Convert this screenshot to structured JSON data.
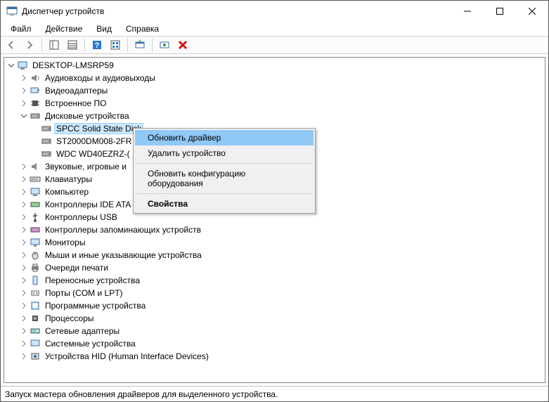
{
  "window": {
    "title": "Диспетчер устройств"
  },
  "menu": {
    "file": "Файл",
    "action": "Действие",
    "view": "Вид",
    "help": "Справка"
  },
  "tree": {
    "root": "DESKTOP-LMSRP59",
    "audio": "Аудиовходы и аудиовыходы",
    "video": "Видеоадаптеры",
    "firmware": "Встроенное ПО",
    "disks": "Дисковые устройства",
    "disk0": "SPCC Solid State Disk",
    "disk1": "ST2000DM008-2FR",
    "disk2": "WDC WD40EZRZ-(",
    "sound": "Звуковые, игровые и",
    "keyboards": "Клавиатуры",
    "computer": "Компьютер",
    "ide": "Контроллеры IDE ATA",
    "usb": "Контроллеры USB",
    "storage": "Контроллеры запоминающих устройств",
    "monitors": "Мониторы",
    "mice": "Мыши и иные указывающие устройства",
    "printq": "Очереди печати",
    "portable": "Переносные устройства",
    "ports": "Порты (COM и LPT)",
    "software": "Программные устройства",
    "cpu": "Процессоры",
    "net": "Сетевые адаптеры",
    "system": "Системные устройства",
    "hid": "Устройства HID (Human Interface Devices)"
  },
  "context_menu": {
    "update": "Обновить драйвер",
    "remove": "Удалить устройство",
    "scan": "Обновить конфигурацию оборудования",
    "props": "Свойства"
  },
  "status": "Запуск мастера обновления драйверов для выделенного устройства."
}
